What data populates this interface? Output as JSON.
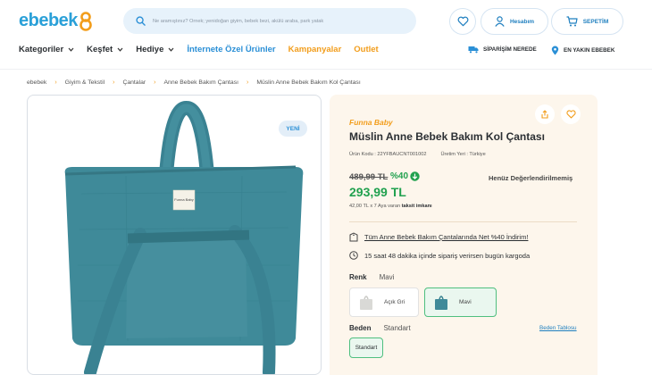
{
  "logo": {
    "text": "ebebek"
  },
  "search": {
    "placeholder": "Ne aramıştınız? Örnek; yenidoğan giyim, bebek bezi, akülü araba, park yatak"
  },
  "header": {
    "account_label": "Hesabım",
    "cart_label": "SEPETİM"
  },
  "nav": {
    "items": [
      {
        "label": "Kategoriler"
      },
      {
        "label": "Keşfet"
      },
      {
        "label": "Hediye"
      }
    ],
    "online_label": "İnternete Özel Ürünler",
    "campaigns_label": "Kampanyalar",
    "outlet_label": "Outlet",
    "order_track_label": "SİPARİŞİM NEREDE",
    "nearest_store_label": "EN YAKIN EBEBEK"
  },
  "breadcrumb": [
    "ebebek",
    "Giyim & Tekstil",
    "Çantalar",
    "Anne Bebek Bakım Çantası",
    "Müslin Anne Bebek Bakım Kol Çantası"
  ],
  "product": {
    "badge": "YENİ",
    "bag_tag": "Funna Baby",
    "brand": "Funna Baby",
    "title": "Müslin Anne Bebek Bakım Kol Çantası",
    "product_code": "Ürün Kodu : 22YFBAUCNT001002",
    "origin": "Üretim Yeri : Türkiye",
    "old_price": "489,99 TL",
    "discount": "%40",
    "price": "293,99 TL",
    "installment_text": "42,00 TL x 7 Aya varan",
    "installment_bold": "taksit imkanı",
    "rating_text": "Henüz Değerlendirilmemiş",
    "promo_text": "Tüm Anne Bebek Bakım Çantalarında Net %40 İndirim!",
    "shipping_text": "15 saat 48 dakika içinde sipariş verirsen bugün kargoda",
    "color_label": "Renk",
    "color_value": "Mavi",
    "variants": [
      {
        "label": "Açık Gri",
        "color": "#d9d9d6"
      },
      {
        "label": "Mavi",
        "color": "#3f8a99"
      }
    ],
    "size_label": "Beden",
    "size_value": "Standart",
    "size_guide": "Beden Tablosu",
    "size_option": "Standart"
  },
  "colors": {
    "brand_blue": "#2aa0d8",
    "accent_orange": "#f29d1b",
    "price_green": "#21a14f",
    "bag_teal": "#3f8a99"
  }
}
